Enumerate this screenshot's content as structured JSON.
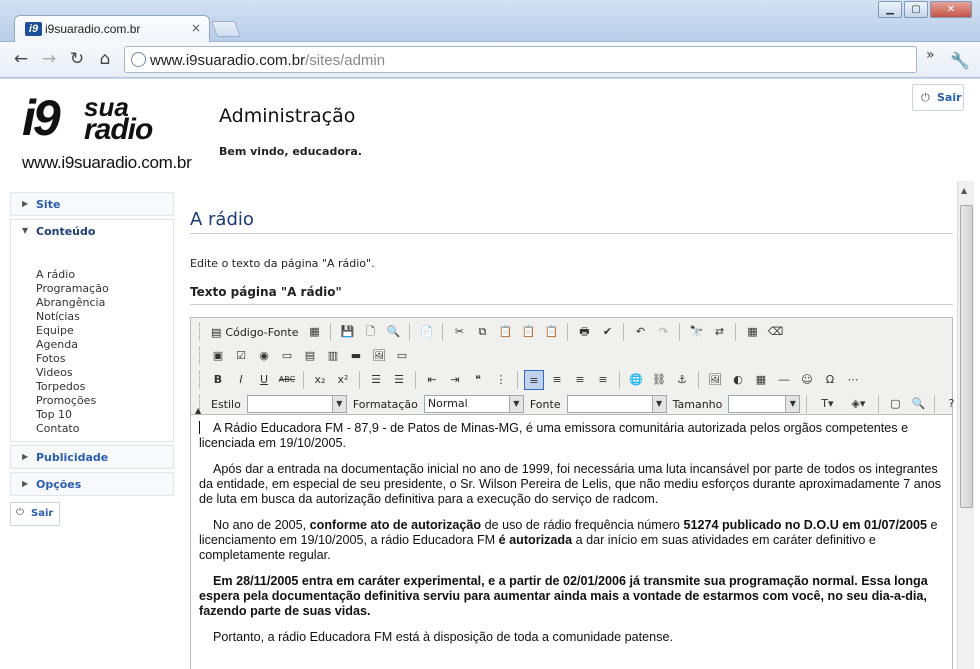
{
  "browser": {
    "tab_title": "i9suaradio.com.br",
    "tab_icon_text": "i9",
    "tab_close": "×",
    "url_domain": "www.i9suaradio.com.br",
    "url_path": "/sites/admin",
    "more_glyph": "»"
  },
  "header": {
    "logo_i9": "i9",
    "logo_sua": "sua",
    "logo_radio": "radio",
    "logo_site": "www.i9suaradio.com.br",
    "title": "Administração",
    "welcome": "Bem vindo, educadora.",
    "logout_label": "Sair"
  },
  "sidebar": {
    "site_label": "Site",
    "conteudo_label": "Conteúdo",
    "conteudo_items": [
      "A rádio",
      "Programação",
      "Abrangência",
      "Notícias",
      "Equipe",
      "Agenda",
      "Fotos",
      "Videos",
      "Torpedos",
      "Promoções",
      "Top 10",
      "Contato"
    ],
    "publicidade_label": "Publicidade",
    "opcoes_label": "Opções",
    "logout_label": "Sair"
  },
  "main": {
    "page_title": "A rádio",
    "description": "Edite o texto da página \"A rádio\".",
    "field_label": "Texto página \"A rádio\""
  },
  "editor": {
    "source_label": "Código-Fonte",
    "style_label": "Estilo",
    "style_value": "",
    "format_label": "Formatação",
    "format_value": "Normal",
    "font_label": "Fonte",
    "font_value": "",
    "size_label": "Tamanho",
    "size_value": "",
    "paragraphs": [
      {
        "parts": [
          {
            "t": "A Rádio Educadora FM - 87,9 - de Patos de Minas-MG, é uma emissora comunitária autorizada pelos orgãos competentes e licenciada em 19/10/2005.",
            "b": false
          }
        ]
      },
      {
        "parts": [
          {
            "t": "Após dar a entrada na documentação inicial no ano de 1999, foi necessária uma luta incansável por parte de todos os integrantes da entidade, em especial de seu presidente, o Sr. Wilson Pereira de Lelis, que não mediu esforços durante aproximadamente 7 anos de luta em busca da autorização definitiva para a execução do serviço de radcom.",
            "b": false
          }
        ]
      },
      {
        "parts": [
          {
            "t": "  No ano de 2005, ",
            "b": false
          },
          {
            "t": "conforme ato de autorização",
            "b": true
          },
          {
            "t": " de uso de rádio frequência número ",
            "b": false
          },
          {
            "t": "51274 publicado no D.O.U em 01/07/2005",
            "b": true
          },
          {
            "t": " e licenciamento em 19/10/2005, a rádio Educadora FM ",
            "b": false
          },
          {
            "t": "é autorizada",
            "b": true
          },
          {
            "t": " a dar início em suas atividades em caráter definitivo e completamente regular.",
            "b": false
          }
        ]
      },
      {
        "parts": [
          {
            "t": "Em 28/11/2005 entra em caráter experimental, e a partir de 02/01/2006 já transmite sua programação normal. Essa longa espera pela documentação definitiva serviu para aumentar ainda mais a vontade de estarmos com você, no seu dia-a-dia, fazendo parte de suas vidas.",
            "b": true
          }
        ]
      },
      {
        "parts": [
          {
            "t": "Portanto, a rádio Educadora FM está à disposição de toda a comunidade patense.",
            "b": false
          }
        ]
      }
    ]
  }
}
